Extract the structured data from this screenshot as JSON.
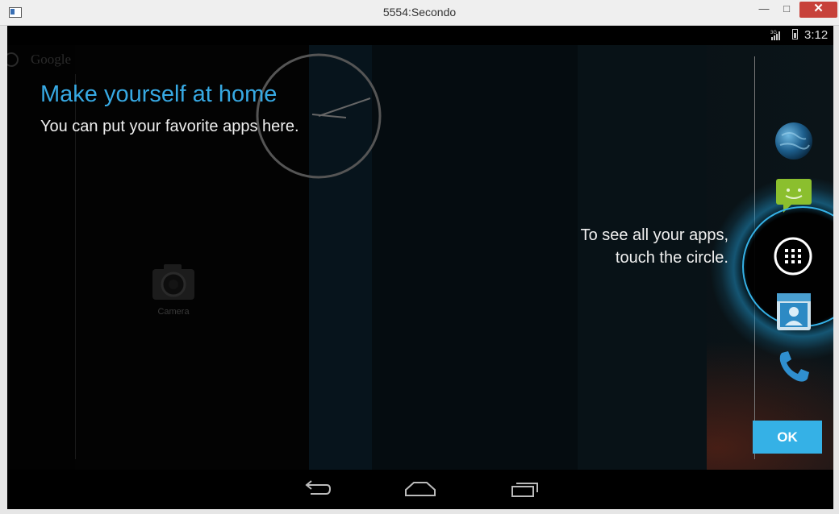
{
  "window": {
    "title": "5554:Secondo",
    "minimize": "—",
    "maximize": "□",
    "close": "✕"
  },
  "status_bar": {
    "network": "3G",
    "time": "3:12"
  },
  "home": {
    "search_hint": "Google",
    "camera_label": "Camera"
  },
  "overlay": {
    "heading": "Make yourself at home",
    "subheading": "You can put your favorite apps here.",
    "hint": "To see all your apps, touch the circle.",
    "ok_label": "OK",
    "accent_color": "#35b1e6"
  },
  "dock": {
    "icons": [
      "browser-icon",
      "messaging-icon",
      "all-apps-icon",
      "contacts-icon",
      "phone-icon"
    ]
  },
  "navigation": {
    "buttons": [
      "back-icon",
      "home-icon",
      "recent-apps-icon"
    ]
  }
}
